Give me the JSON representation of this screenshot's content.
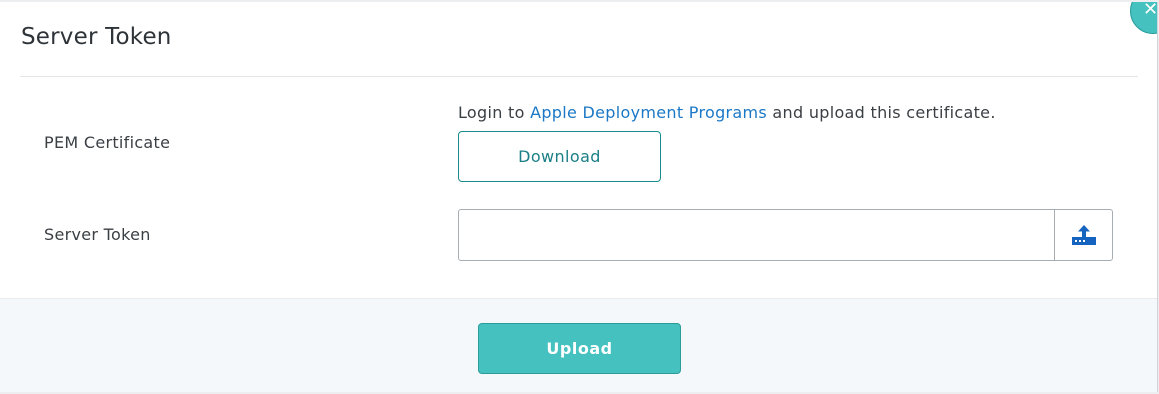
{
  "dialog": {
    "title": "Server Token",
    "close_symbol": "✕"
  },
  "pem": {
    "label": "PEM Certificate",
    "instruction_prefix": "Login to ",
    "instruction_link": "Apple Deployment Programs",
    "instruction_suffix": " and upload this certificate.",
    "download_label": "Download"
  },
  "token": {
    "label": "Server Token",
    "value": "",
    "placeholder": "",
    "upload_icon": "upload-icon"
  },
  "footer": {
    "upload_label": "Upload"
  },
  "colors": {
    "accent": "#45c1bf",
    "link": "#1b78c6",
    "icon_blue": "#1565c0"
  }
}
